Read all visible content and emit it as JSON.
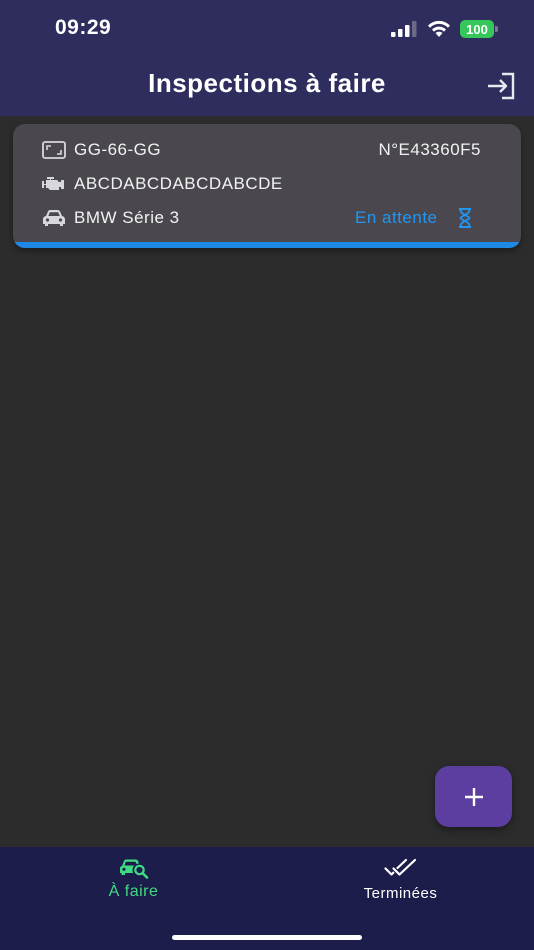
{
  "status_bar": {
    "time": "09:29",
    "battery": "100",
    "battery_color": "#35c759"
  },
  "header": {
    "title": "Inspections à faire",
    "logout_icon": "logout-icon"
  },
  "inspections": [
    {
      "plate": "GG-66-GG",
      "number": "N°E43360F5",
      "vin": "ABCDABCDABCDABCDE",
      "model": "BMW Série 3",
      "status": "En attente",
      "status_color": "#2196f3"
    }
  ],
  "fab": {
    "icon": "plus-icon"
  },
  "bottom_nav": {
    "items": [
      {
        "label": "À faire",
        "icon": "car-search-icon",
        "active": true,
        "color": "#3ddc84"
      },
      {
        "label": "Terminées",
        "icon": "double-check-icon",
        "active": false,
        "color": "#ffffff"
      }
    ]
  },
  "colors": {
    "header_bg": "#2e2d5e",
    "body_bg": "#2c2c2c",
    "card_bg": "#4a484e",
    "accent_blue": "#1e88e5",
    "fab_bg": "#5b3ea0",
    "nav_bg": "#1c1d4a"
  }
}
